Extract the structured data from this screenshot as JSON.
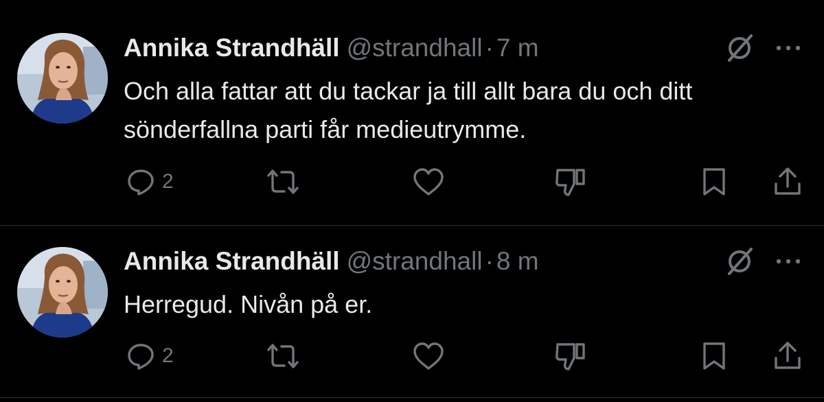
{
  "colors": {
    "background": "#000000",
    "text_primary": "#e7e9ea",
    "text_secondary": "#71767b",
    "divider": "#2f3336"
  },
  "tweets": [
    {
      "author_name": "Annika Strandhäll",
      "handle": "@strandhall",
      "separator": "·",
      "time": "7 m",
      "text": "Och alla fattar att du tackar ja till allt bara du och ditt sönderfallna parti får medieutrymme.",
      "reply_count": "2",
      "icons": [
        "avatar",
        "grok-icon",
        "more-icon",
        "reply-icon",
        "retweet-icon",
        "like-icon",
        "downvote-icon",
        "bookmark-icon",
        "share-icon"
      ]
    },
    {
      "author_name": "Annika Strandhäll",
      "handle": "@strandhall",
      "separator": "·",
      "time": "8 m",
      "text": "Herregud. Nivån på er.",
      "reply_count": "2",
      "icons": [
        "avatar",
        "grok-icon",
        "more-icon",
        "reply-icon",
        "retweet-icon",
        "like-icon",
        "downvote-icon",
        "bookmark-icon",
        "share-icon"
      ]
    }
  ]
}
